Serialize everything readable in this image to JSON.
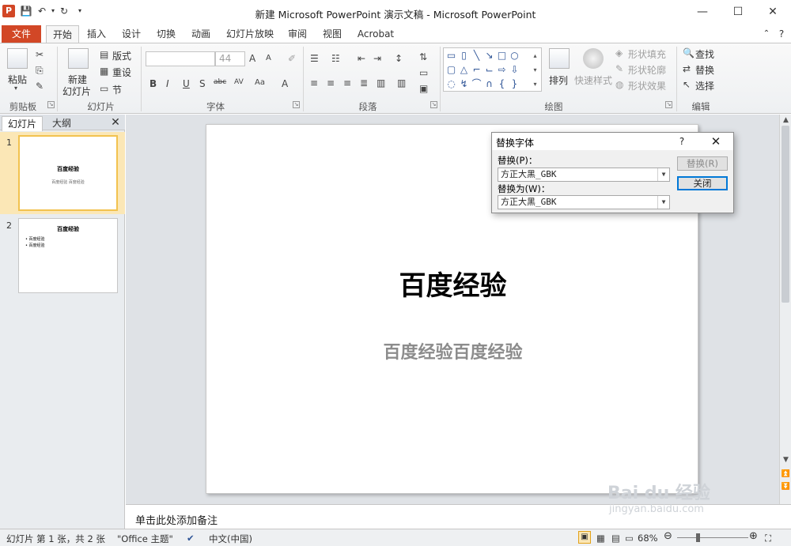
{
  "window": {
    "title": "新建 Microsoft PowerPoint 演示文稿 - Microsoft PowerPoint",
    "logo": "P",
    "minimize": "—",
    "maximize": "☐",
    "close": "✕"
  },
  "tabs": {
    "file": "文件",
    "items": [
      "开始",
      "插入",
      "设计",
      "切换",
      "动画",
      "幻灯片放映",
      "审阅",
      "视图",
      "Acrobat"
    ]
  },
  "ribbon": {
    "clipboard": {
      "label": "剪贴板",
      "paste": "粘贴"
    },
    "slides": {
      "label": "幻灯片",
      "new_slide_1": "新建",
      "new_slide_2": "幻灯片",
      "layout": "版式",
      "reset": "重设",
      "section": "节"
    },
    "font": {
      "label": "字体",
      "font_size": "44"
    },
    "paragraph": {
      "label": "段落"
    },
    "drawing": {
      "label": "绘图",
      "arrange": "排列",
      "quick_styles": "快速样式",
      "shape_fill": "形状填充",
      "shape_outline": "形状轮廓",
      "shape_effects": "形状效果"
    },
    "editing": {
      "label": "编辑",
      "find": "查找",
      "replace": "替换",
      "select": "选择"
    }
  },
  "left_pane": {
    "tab_slides": "幻灯片",
    "tab_outline": "大纲",
    "close": "✕",
    "slides": [
      {
        "num": "1",
        "title": "百度经验",
        "subtitle": "百度经验 百度经验"
      },
      {
        "num": "2",
        "title": "百度经验",
        "bullets": [
          "百度经验",
          "百度经验"
        ]
      }
    ]
  },
  "slide": {
    "title": "百度经验",
    "subtitle": "百度经验百度经验"
  },
  "notes": {
    "placeholder": "单击此处添加备注"
  },
  "status": {
    "slide_info": "幻灯片 第 1 张，共 2 张",
    "theme": "\"Office 主题\"",
    "language": "中文(中国)",
    "zoom": "68%"
  },
  "dialog": {
    "title": "替换字体",
    "help": "?",
    "close": "✕",
    "replace_label": "替换(P)：",
    "replace_value": "方正大黑_GBK",
    "with_label": "替换为(W)：",
    "with_value": "方正大黑_GBK",
    "btn_replace": "替换(R)",
    "btn_close": "关闭"
  },
  "watermark": {
    "main": "Bai du 经验",
    "sub": "jingyan.baidu.com"
  }
}
